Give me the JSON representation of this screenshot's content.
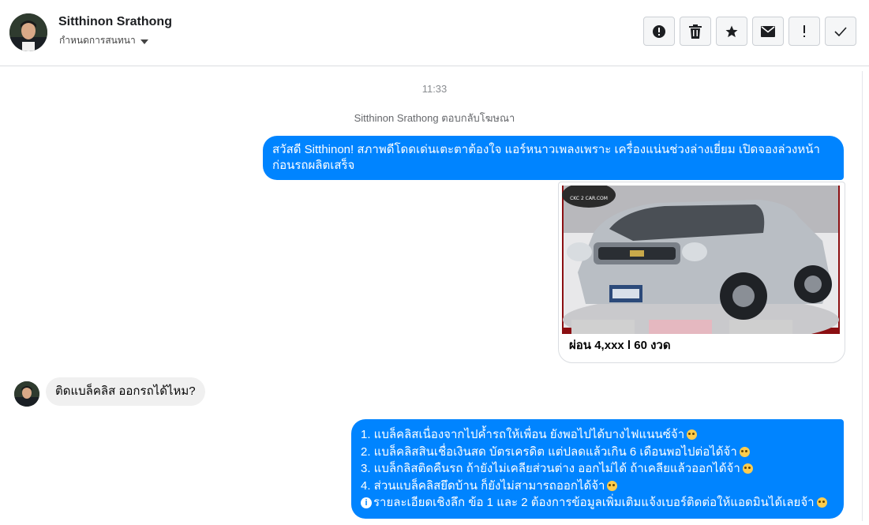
{
  "header": {
    "contact_name": "Sitthinon Srathong",
    "subtitle": "กำหนดการสนทนา",
    "toolbar": [
      {
        "name": "spam-button",
        "icon": "alert-circle-icon"
      },
      {
        "name": "delete-button",
        "icon": "trash-icon"
      },
      {
        "name": "star-button",
        "icon": "star-icon"
      },
      {
        "name": "mark-unread-button",
        "icon": "mail-icon"
      },
      {
        "name": "important-button",
        "icon": "exclamation-icon"
      },
      {
        "name": "done-button",
        "icon": "check-icon"
      }
    ]
  },
  "thread": {
    "timestamp": "11:33",
    "reply_note": "Sitthinon Srathong ตอบกลับโฆษณา",
    "outgoing_1": "สวัสดี Sitthinon! สภาพดีโดดเด่นเตะตาต้องใจ แอร์หนาวเพลงเพราะ เครื่องแน่นช่วงล่างเยี่ยม เปิดจองล่วงหน้าก่อนรถผลิตเสร็จ",
    "card": {
      "caption": "ผ่อน 4,xxx l 60 งวด",
      "image_alt": "silver pickup truck photo",
      "watermark": "CKC 2 CAR.COM"
    },
    "incoming_1": "ติดแบล็คลิส ออกรถได้ไหม?",
    "outgoing_2": [
      "1. แบล็คลิสเนื่องจากไปค้ำรถให้เพื่อน ยังพอไปได้บางไฟแนนซ์จ้า",
      "2. แบล็คลิสสินเชื่อเงินสด บัตรเครดิต แต่ปลดแล้วเกิน 6 เดือนพอไปต่อได้จ้า",
      "3. แบล็กลิสติดคืนรถ ถ้ายังไม่เคลียส่วนต่าง ออกไม่ได้ ถ้าเคลียแล้วออกได้จ้า",
      "4. ส่วนแบล็คลิสยึดบ้าน ก็ยังไม่สามารถออกได้จ้า",
      "รายละเอียดเชิงลึก ข้อ 1 และ 2 ต้องการข้อมูลเพิ่มเติมแจ้งเบอร์ติดต่อให้แอดมินได้เลยจ้า"
    ]
  },
  "colors": {
    "outgoing_bubble": "#0084ff",
    "incoming_bubble": "#f0f0f0"
  }
}
